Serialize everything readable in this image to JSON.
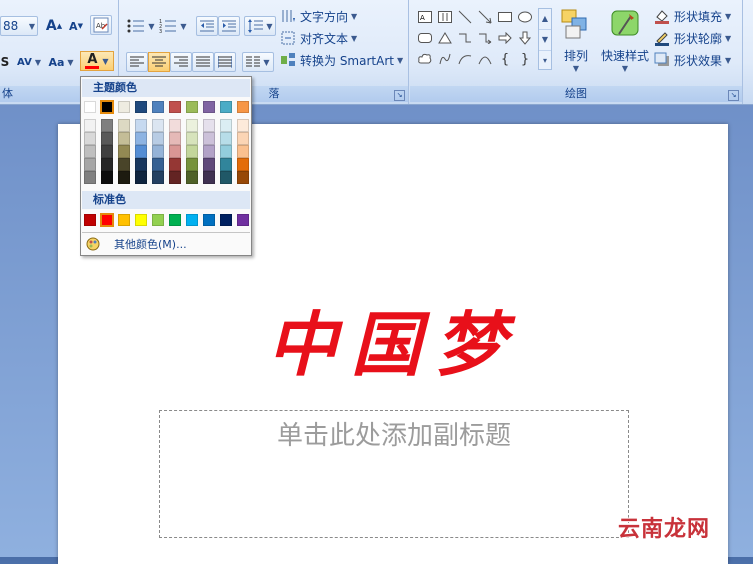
{
  "ribbon": {
    "font_group": {
      "label": "体",
      "size_value": "88",
      "grow_font": "A",
      "shrink_font": "A",
      "change_case": "Aa",
      "char_spacing": "AV",
      "shadow": "S",
      "font_color": "A"
    },
    "paragraph_group": {
      "label": "落",
      "text_direction": "文字方向",
      "align_text": "对齐文本",
      "convert_smartart": "转换为 SmartArt"
    },
    "drawing_group": {
      "label": "绘图",
      "arrange": "排列",
      "quick_styles": "快速样式",
      "shape_fill": "形状填充",
      "shape_outline": "形状轮廓",
      "shape_effects": "形状效果"
    }
  },
  "picker": {
    "theme_label": "主题颜色",
    "standard_label": "标准色",
    "more_colors": "其他颜色(M)...",
    "theme_top": [
      "#ffffff",
      "#000000",
      "#eeece1",
      "#1f497d",
      "#4f81bd",
      "#c0504d",
      "#9bbb59",
      "#8064a2",
      "#4bacc6",
      "#f79646"
    ],
    "theme_shades": [
      [
        "#f2f2f2",
        "#d9d9d9",
        "#bfbfbf",
        "#a6a6a6",
        "#808080"
      ],
      [
        "#7f7f7f",
        "#595959",
        "#404040",
        "#262626",
        "#0d0d0d"
      ],
      [
        "#ddd9c3",
        "#c4bd97",
        "#938953",
        "#494429",
        "#1d1b10"
      ],
      [
        "#c6d9f0",
        "#8db3e2",
        "#548dd4",
        "#17365d",
        "#0f243e"
      ],
      [
        "#dbe5f1",
        "#b8cce4",
        "#95b3d7",
        "#366092",
        "#244061"
      ],
      [
        "#f2dcdb",
        "#e5b9b7",
        "#d99694",
        "#953734",
        "#632423"
      ],
      [
        "#ebf1dd",
        "#d7e3bc",
        "#c3d69b",
        "#76923c",
        "#4f6128"
      ],
      [
        "#e5e0ec",
        "#ccc1d9",
        "#b2a2c7",
        "#5f497a",
        "#3f3151"
      ],
      [
        "#dbeef3",
        "#b7dde8",
        "#92cddc",
        "#31859b",
        "#205867"
      ],
      [
        "#fdeada",
        "#fbd5b5",
        "#fac08f",
        "#e36c09",
        "#974806"
      ]
    ],
    "standard": [
      "#c00000",
      "#ff0000",
      "#ffc000",
      "#ffff00",
      "#92d050",
      "#00b050",
      "#00b0f0",
      "#0070c0",
      "#002060",
      "#7030a0"
    ]
  },
  "slide": {
    "title": "中国梦",
    "subtitle_placeholder": "单击此处添加副标题"
  },
  "watermark": "云南龙网",
  "colors": {
    "accent_text": "#15428b",
    "title_red": "#e8101a",
    "selected_outline": "#e48a0c"
  }
}
